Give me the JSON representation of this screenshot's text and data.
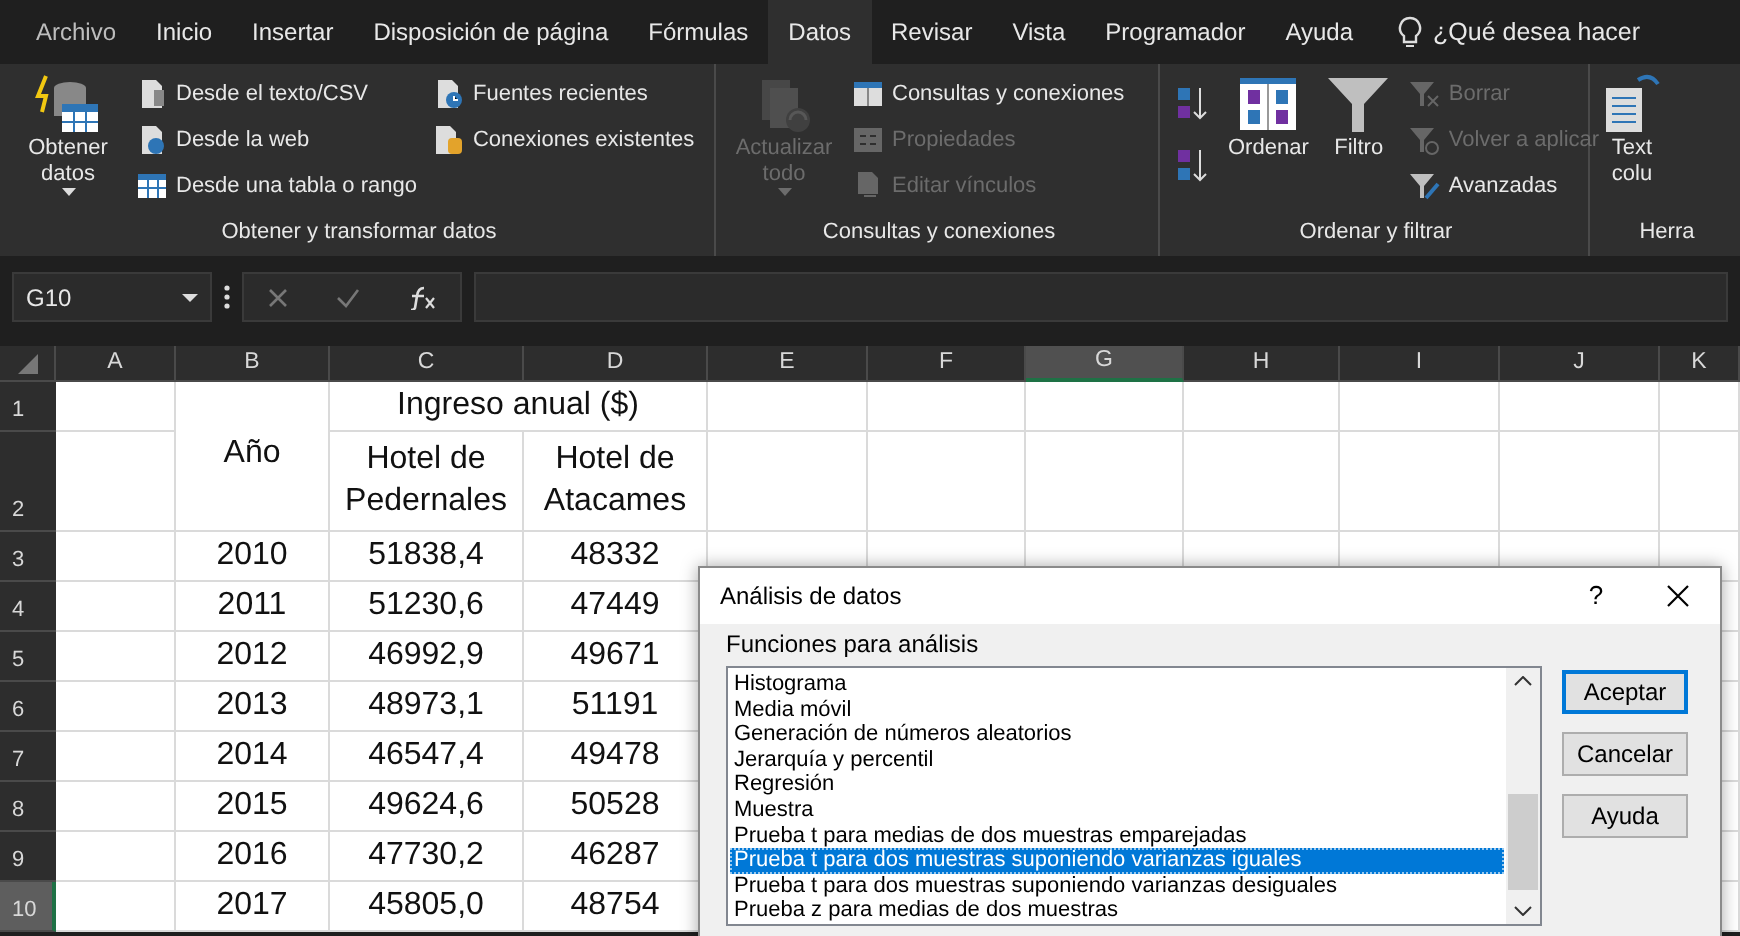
{
  "menu_tabs": [
    {
      "label": "Archivo",
      "selected": false
    },
    {
      "label": "Inicio",
      "selected": false
    },
    {
      "label": "Insertar",
      "selected": false
    },
    {
      "label": "Disposición de página",
      "selected": false
    },
    {
      "label": "Fórmulas",
      "selected": false
    },
    {
      "label": "Datos",
      "selected": true
    },
    {
      "label": "Revisar",
      "selected": false
    },
    {
      "label": "Vista",
      "selected": false
    },
    {
      "label": "Programador",
      "selected": false
    },
    {
      "label": "Ayuda",
      "selected": false
    }
  ],
  "tell_me": "¿Qué desea hacer",
  "ribbon_groups": [
    {
      "label": "Obtener y transformar datos",
      "columns": [
        [
          {
            "kind": "large",
            "label": "Obtener datos",
            "dropdown": true,
            "disabled": false
          }
        ],
        [
          {
            "kind": "small",
            "label": "Desde el texto/CSV",
            "disabled": false
          },
          {
            "kind": "small",
            "label": "Desde la web",
            "disabled": false
          },
          {
            "kind": "small",
            "label": "Desde una tabla o rango",
            "disabled": false
          }
        ],
        [
          {
            "kind": "small",
            "label": "Fuentes recientes",
            "disabled": false
          },
          {
            "kind": "small",
            "label": "Conexiones existentes",
            "disabled": false
          }
        ]
      ]
    },
    {
      "label": "Consultas y conexiones",
      "columns": [
        [
          {
            "kind": "large",
            "label": "Actualizar todo",
            "dropdown": true,
            "disabled": true
          }
        ],
        [
          {
            "kind": "small",
            "label": "Consultas y conexiones",
            "disabled": false
          },
          {
            "kind": "small",
            "label": "Propiedades",
            "disabled": true
          },
          {
            "kind": "small",
            "label": "Editar vínculos",
            "disabled": true
          }
        ]
      ]
    },
    {
      "label": "Ordenar y filtrar",
      "columns": [
        [
          {
            "kind": "icon",
            "disabled": false
          },
          {
            "kind": "icon",
            "disabled": false
          }
        ],
        [
          {
            "kind": "large",
            "label": "Ordenar",
            "dropdown": false,
            "disabled": false
          }
        ],
        [
          {
            "kind": "large",
            "label": "Filtro",
            "dropdown": false,
            "disabled": false
          }
        ],
        [
          {
            "kind": "small",
            "label": "Borrar",
            "disabled": true
          },
          {
            "kind": "small",
            "label": "Volver a aplicar",
            "disabled": true
          },
          {
            "kind": "small",
            "label": "Avanzadas",
            "disabled": false
          }
        ]
      ]
    },
    {
      "label": "Herra",
      "columns": [
        [
          {
            "kind": "large",
            "label": "Text colu",
            "dropdown": false,
            "disabled": false
          }
        ]
      ]
    }
  ],
  "name_box": "G10",
  "columns": [
    {
      "label": "A",
      "selected": false
    },
    {
      "label": "B",
      "selected": false
    },
    {
      "label": "C",
      "selected": false
    },
    {
      "label": "D",
      "selected": false
    },
    {
      "label": "E",
      "selected": false
    },
    {
      "label": "F",
      "selected": false
    },
    {
      "label": "G",
      "selected": true
    },
    {
      "label": "H",
      "selected": false
    },
    {
      "label": "I",
      "selected": false
    },
    {
      "label": "J",
      "selected": false
    },
    {
      "label": "K",
      "selected": false
    }
  ],
  "rows": [
    {
      "label": "1",
      "selected": false,
      "cells": {
        "C": "Ingreso anual ($)"
      }
    },
    {
      "label": "2",
      "selected": false,
      "cells": {
        "B": "Año",
        "C": "Hotel de Pedernales",
        "D": "Hotel de Atacames"
      }
    },
    {
      "label": "3",
      "selected": false,
      "cells": {
        "B": "2010",
        "C": "51838,4",
        "D": "48332"
      }
    },
    {
      "label": "4",
      "selected": false,
      "cells": {
        "B": "2011",
        "C": "51230,6",
        "D": "47449"
      }
    },
    {
      "label": "5",
      "selected": false,
      "cells": {
        "B": "2012",
        "C": "46992,9",
        "D": "49671"
      }
    },
    {
      "label": "6",
      "selected": false,
      "cells": {
        "B": "2013",
        "C": "48973,1",
        "D": "51191"
      }
    },
    {
      "label": "7",
      "selected": false,
      "cells": {
        "B": "2014",
        "C": "46547,4",
        "D": "49478"
      }
    },
    {
      "label": "8",
      "selected": false,
      "cells": {
        "B": "2015",
        "C": "49624,6",
        "D": "50528"
      }
    },
    {
      "label": "9",
      "selected": false,
      "cells": {
        "B": "2016",
        "C": "47730,2",
        "D": "46287"
      }
    },
    {
      "label": "10",
      "selected": true,
      "cells": {
        "B": "2017",
        "C": "45805,0",
        "D": "48754"
      }
    }
  ],
  "dialog": {
    "title": "Análisis de datos",
    "help": "?",
    "list_label": "Funciones para análisis",
    "items": [
      {
        "label": "Histograma",
        "selected": false
      },
      {
        "label": "Media móvil",
        "selected": false
      },
      {
        "label": "Generación de números aleatorios",
        "selected": false
      },
      {
        "label": "Jerarquía y percentil",
        "selected": false
      },
      {
        "label": "Regresión",
        "selected": false
      },
      {
        "label": "Muestra",
        "selected": false
      },
      {
        "label": "Prueba t para medias de dos muestras emparejadas",
        "selected": false
      },
      {
        "label": "Prueba t para dos muestras suponiendo varianzas iguales",
        "selected": true
      },
      {
        "label": "Prueba t para dos muestras suponiendo varianzas desiguales",
        "selected": false
      },
      {
        "label": "Prueba z para medias de dos muestras",
        "selected": false
      }
    ],
    "buttons": [
      {
        "label": "Aceptar",
        "default": true
      },
      {
        "label": "Cancelar",
        "default": false
      },
      {
        "label": "Ayuda",
        "default": false
      }
    ]
  }
}
